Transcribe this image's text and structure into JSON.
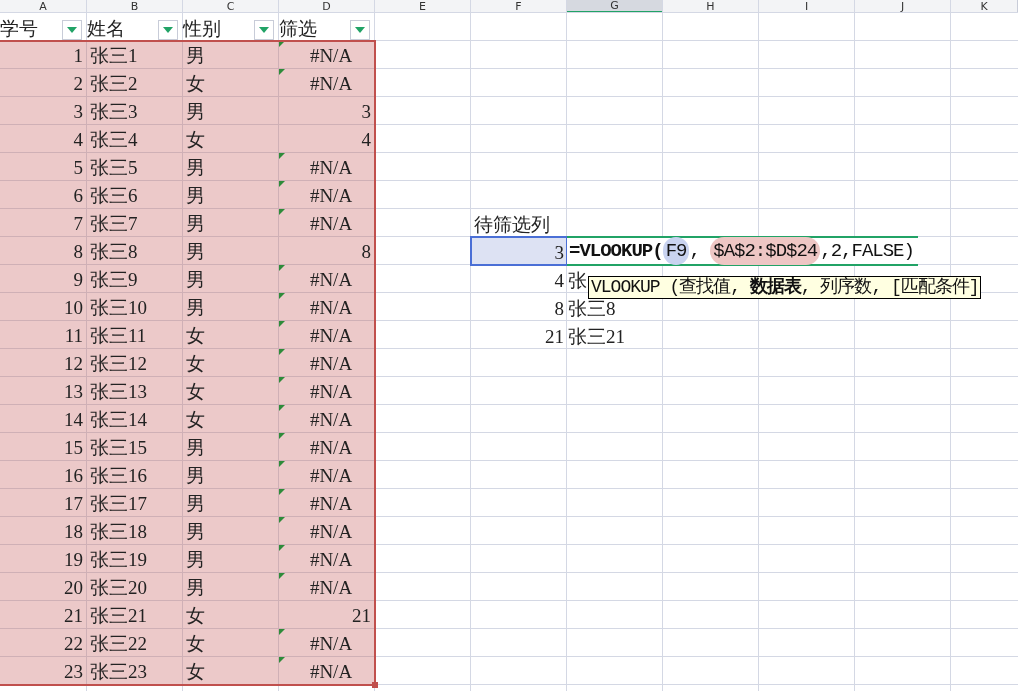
{
  "column_headers": [
    {
      "label": "A",
      "selected": false
    },
    {
      "label": "B",
      "selected": false
    },
    {
      "label": "C",
      "selected": false
    },
    {
      "label": "D",
      "selected": false
    },
    {
      "label": "E",
      "selected": false
    },
    {
      "label": "F",
      "selected": false
    },
    {
      "label": "G",
      "selected": true
    },
    {
      "label": "H",
      "selected": false
    },
    {
      "label": "I",
      "selected": false
    },
    {
      "label": "J",
      "selected": false
    },
    {
      "label": "K",
      "selected": false
    }
  ],
  "table": {
    "columns": [
      {
        "label": "学号"
      },
      {
        "label": "姓名"
      },
      {
        "label": "性别"
      },
      {
        "label": "筛选"
      }
    ],
    "rows": [
      {
        "cells": [
          "1",
          "张三1",
          "男",
          "#N/A"
        ],
        "flagged": true
      },
      {
        "cells": [
          "2",
          "张三2",
          "女",
          "#N/A"
        ],
        "flagged": true
      },
      {
        "cells": [
          "3",
          "张三3",
          "男",
          "3"
        ],
        "flagged": false
      },
      {
        "cells": [
          "4",
          "张三4",
          "女",
          "4"
        ],
        "flagged": false
      },
      {
        "cells": [
          "5",
          "张三5",
          "男",
          "#N/A"
        ],
        "flagged": true
      },
      {
        "cells": [
          "6",
          "张三6",
          "男",
          "#N/A"
        ],
        "flagged": true
      },
      {
        "cells": [
          "7",
          "张三7",
          "男",
          "#N/A"
        ],
        "flagged": true
      },
      {
        "cells": [
          "8",
          "张三8",
          "男",
          "8"
        ],
        "flagged": false
      },
      {
        "cells": [
          "9",
          "张三9",
          "男",
          "#N/A"
        ],
        "flagged": true
      },
      {
        "cells": [
          "10",
          "张三10",
          "男",
          "#N/A"
        ],
        "flagged": true
      },
      {
        "cells": [
          "11",
          "张三11",
          "女",
          "#N/A"
        ],
        "flagged": true
      },
      {
        "cells": [
          "12",
          "张三12",
          "女",
          "#N/A"
        ],
        "flagged": true
      },
      {
        "cells": [
          "13",
          "张三13",
          "女",
          "#N/A"
        ],
        "flagged": true
      },
      {
        "cells": [
          "14",
          "张三14",
          "女",
          "#N/A"
        ],
        "flagged": true
      },
      {
        "cells": [
          "15",
          "张三15",
          "男",
          "#N/A"
        ],
        "flagged": true
      },
      {
        "cells": [
          "16",
          "张三16",
          "男",
          "#N/A"
        ],
        "flagged": true
      },
      {
        "cells": [
          "17",
          "张三17",
          "男",
          "#N/A"
        ],
        "flagged": true
      },
      {
        "cells": [
          "18",
          "张三18",
          "男",
          "#N/A"
        ],
        "flagged": true
      },
      {
        "cells": [
          "19",
          "张三19",
          "男",
          "#N/A"
        ],
        "flagged": true
      },
      {
        "cells": [
          "20",
          "张三20",
          "男",
          "#N/A"
        ],
        "flagged": true
      },
      {
        "cells": [
          "21",
          "张三21",
          "女",
          "21"
        ],
        "flagged": false
      },
      {
        "cells": [
          "22",
          "张三22",
          "女",
          "#N/A"
        ],
        "flagged": true
      },
      {
        "cells": [
          "23",
          "张三23",
          "女",
          "#N/A"
        ],
        "flagged": true
      }
    ]
  },
  "lookup": {
    "header": "待筛选列",
    "rows": [
      {
        "value": "3",
        "selected": true
      },
      {
        "value": "4",
        "result": "张",
        "selected": false
      },
      {
        "value": "8",
        "result": "张三8",
        "selected": false
      },
      {
        "value": "21",
        "result": "张三21",
        "selected": false
      }
    ]
  },
  "editor": {
    "parts": [
      {
        "text": "=VLOOKUP(",
        "kind": "function"
      },
      {
        "text": "F9",
        "kind": "ref",
        "color": "#c9d3f0"
      },
      {
        "text": ", ",
        "kind": "plain"
      },
      {
        "text": "$A$2:$D$24",
        "kind": "ref",
        "color": "#eec6c4"
      },
      {
        "text": ",2,FALSE)",
        "kind": "plain"
      }
    ],
    "tooltip": "VLOOKUP (查找值, **数据表**, 列序数, [匹配条件]"
  }
}
